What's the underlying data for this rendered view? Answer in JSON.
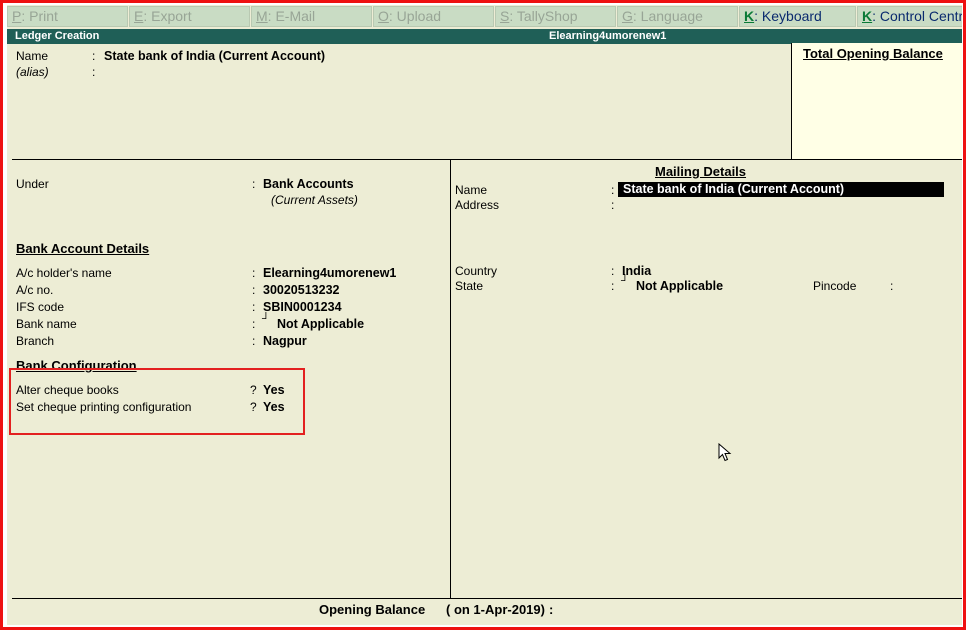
{
  "toolbar": {
    "buttons": [
      {
        "key": "P",
        "label": ": Print",
        "active": false
      },
      {
        "key": "E",
        "label": ": Export",
        "active": false
      },
      {
        "key": "M",
        "label": ": E-Mail",
        "active": false
      },
      {
        "key": "O",
        "label": ": Upload",
        "active": false
      },
      {
        "key": "S",
        "label": ": TallyShop",
        "active": false
      },
      {
        "key": "G",
        "label": ": Language",
        "active": false
      },
      {
        "key": "K",
        "label": ": Keyboard",
        "active": true
      },
      {
        "key": "K",
        "label": ": Control Centre",
        "active": true
      }
    ]
  },
  "titlebar": {
    "screen_title": "Ledger Creation",
    "company": "Elearning4umorenew1"
  },
  "ledger": {
    "name_label": "Name",
    "name_value": "State bank of India (Current Account)",
    "alias_label": "(alias)",
    "colon": ":"
  },
  "opening_box": {
    "title": "Total Opening Balance"
  },
  "left": {
    "under_label": "Under",
    "under_value": "Bank Accounts",
    "under_parent": "(Current Assets)",
    "bank_details_title": "Bank Account Details",
    "fields": [
      {
        "label": "A/c holder's name",
        "value": "Elearning4umorenew1"
      },
      {
        "label": "A/c no.",
        "value": "30020513232"
      },
      {
        "label": "IFS code",
        "value": "SBIN0001234"
      },
      {
        "label": "Bank name",
        "value": "Not Applicable"
      },
      {
        "label": "Branch",
        "value": "Nagpur"
      }
    ],
    "bank_config_title": "Bank Configuration",
    "config": [
      {
        "label": "Alter cheque books",
        "value": "Yes"
      },
      {
        "label": "Set cheque printing configuration",
        "value": "Yes"
      }
    ],
    "question": "?"
  },
  "mailing": {
    "title": "Mailing Details",
    "name_label": "Name",
    "name_value": "State bank of India (Current Account)",
    "address_label": "Address",
    "country_label": "Country",
    "country_value": "India",
    "state_label": "State",
    "state_value": "Not Applicable",
    "pincode_label": "Pincode"
  },
  "footer": {
    "opening_label": "Opening Balance",
    "opening_date": "( on 1-Apr-2019)",
    "colon": ":"
  },
  "colors": {
    "background": "#ededd5",
    "titlebar": "#1f5f57",
    "toolbar_button": "#c9dcc4",
    "highlight": "#e32020"
  }
}
